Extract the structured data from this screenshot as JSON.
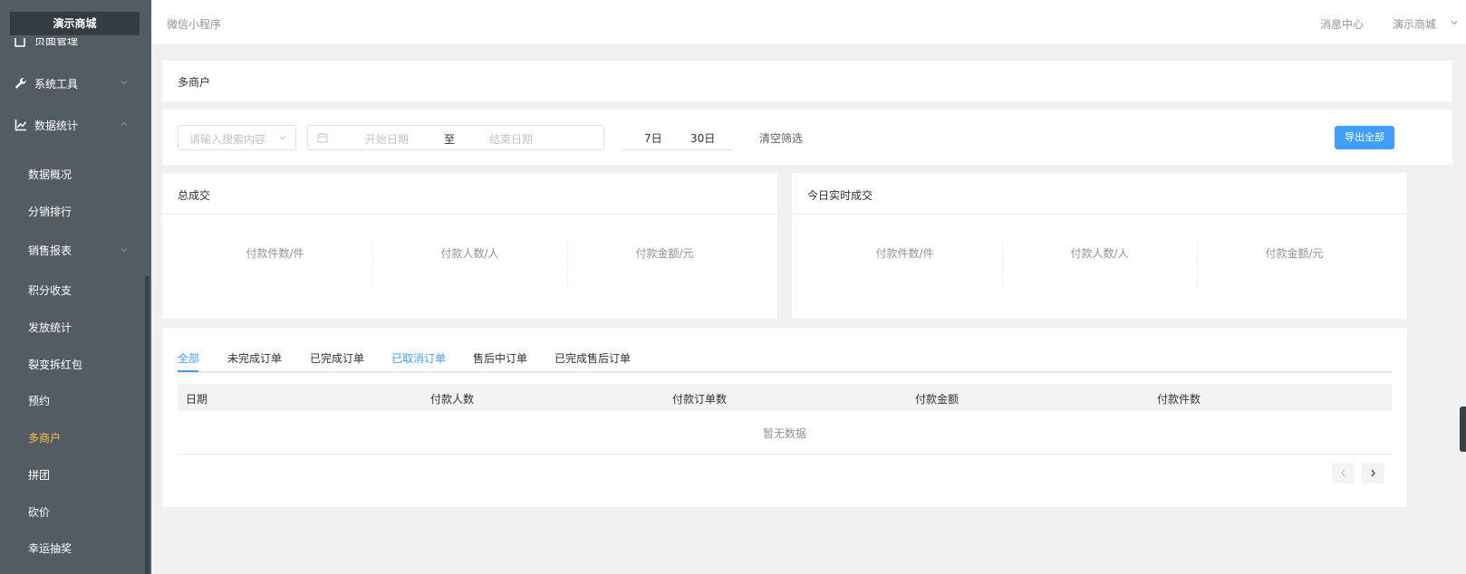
{
  "sidebar": {
    "brand": "演示商城",
    "partial_item": "页面管理",
    "groups": [
      {
        "label": "系统工具",
        "icon": "wrench-icon"
      },
      {
        "label": "数据统计",
        "icon": "chart-line-icon"
      }
    ],
    "sub_items": [
      {
        "label": "数据概况"
      },
      {
        "label": "分销排行"
      },
      {
        "label": "销售报表"
      },
      {
        "label": "积分收支"
      },
      {
        "label": "发放统计"
      },
      {
        "label": "裂变拆红包"
      },
      {
        "label": "预约"
      },
      {
        "label": "多商户"
      },
      {
        "label": "拼团"
      },
      {
        "label": "砍价"
      },
      {
        "label": "幸运抽奖"
      }
    ],
    "active_color": "#ffbf3c"
  },
  "header": {
    "title": "微信小程序",
    "message_center": "消息中心",
    "shop_name": "演示商城"
  },
  "page": {
    "title": "多商户"
  },
  "filters": {
    "search_placeholder": "请输入搜索内容",
    "start_placeholder": "开始日期",
    "range_separator": "至",
    "end_placeholder": "结束日期",
    "quick_7": "7日",
    "quick_30": "30日",
    "clear_label": "清空筛选",
    "export_label": "导出全部"
  },
  "stats": {
    "total": {
      "title": "总成交",
      "cols": [
        "付款件数/件",
        "付款人数/人",
        "付款金额/元"
      ]
    },
    "today": {
      "title": "今日实时成交",
      "cols": [
        "付款件数/件",
        "付款人数/人",
        "付款金额/元"
      ]
    }
  },
  "orders": {
    "tabs": [
      "全部",
      "未完成订单",
      "已完成订单",
      "已取消订单",
      "售后中订单",
      "已完成售后订单"
    ],
    "columns": [
      "日期",
      "付款人数",
      "付款订单数",
      "付款金额",
      "付款件数"
    ],
    "empty_text": "暂无数据"
  },
  "colors": {
    "accent": "#409eff",
    "sidebar_bg": "#535b63",
    "brand_bg": "#343b41"
  }
}
